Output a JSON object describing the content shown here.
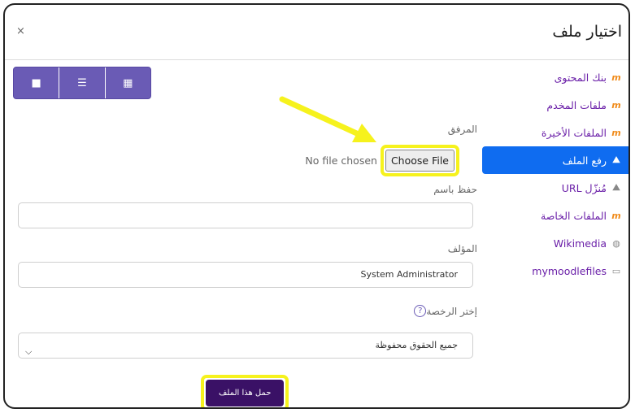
{
  "dialog": {
    "title": "اختيار ملف",
    "close_label": "×"
  },
  "sidebar": {
    "items": [
      {
        "label": "بنك المحتوى",
        "icon": "moodle-icon"
      },
      {
        "label": "ملفات المخدم",
        "icon": "moodle-icon"
      },
      {
        "label": "الملفات الأخيرة",
        "icon": "moodle-icon"
      },
      {
        "label": "رفع الملف",
        "icon": "upload-icon",
        "active": true
      },
      {
        "label": "مُنزّل URL",
        "icon": "url-icon"
      },
      {
        "label": "الملفات الخاصة",
        "icon": "moodle-icon"
      },
      {
        "label": "Wikimedia",
        "icon": "wikimedia-icon"
      },
      {
        "label": "mymoodlefiles",
        "icon": "folder-icon"
      }
    ]
  },
  "viewbar": {
    "icons": [
      "folder-view-icon",
      "list-view-icon",
      "grid-view-icon"
    ]
  },
  "form": {
    "attachment_label": "المرفق",
    "no_file_text": "No file chosen",
    "choose_file_label": "Choose File",
    "save_as_label": "حفظ باسم",
    "save_as_value": "",
    "author_label": "المؤلف",
    "author_value": "System Administrator",
    "license_label": "إختر الرخصة",
    "license_value": "جميع الحقوق محفوظة",
    "upload_button": "حمل هذا الملف"
  },
  "colors": {
    "accent": "#0f6cf0",
    "brand": "#6a5bb5",
    "highlight": "#f6f21d",
    "primary_button": "#3a1166"
  }
}
